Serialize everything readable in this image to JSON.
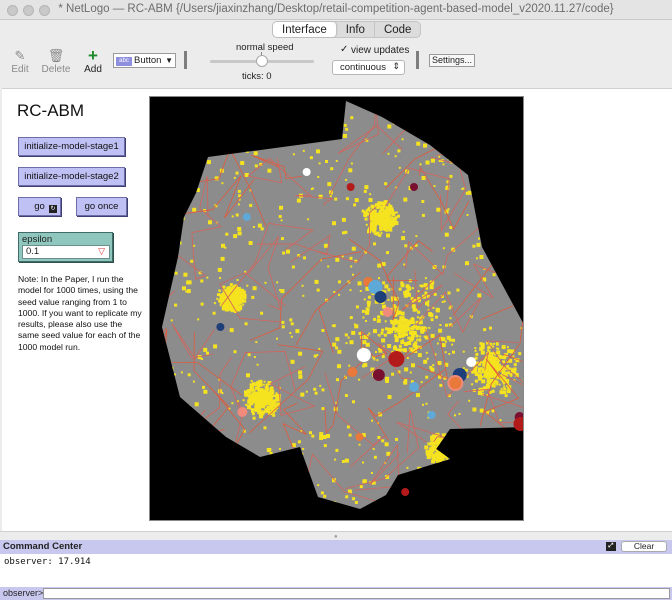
{
  "window": {
    "title": "* NetLogo — RC-ABM {/Users/jiaxinzhang/Desktop/retail-competition-agent-based-model_v2020.11.27/code}"
  },
  "tabs": [
    {
      "label": "Interface",
      "active": true
    },
    {
      "label": "Info",
      "active": false
    },
    {
      "label": "Code",
      "active": false
    }
  ],
  "toolbar": {
    "edit_label": "Edit",
    "delete_label": "Delete",
    "add_label": "Add",
    "widget_type": "Button",
    "widget_type_icon": "abc",
    "speed_label": "normal speed",
    "ticks_label": "ticks: 0",
    "view_updates_label": "view updates",
    "view_updates_checked": true,
    "update_mode": "continuous",
    "settings_label": "Settings..."
  },
  "interface": {
    "model_title": "RC-ABM",
    "buttons": {
      "init1": "initialize-model-stage1",
      "init2": "initialize-model-stage2",
      "go": "go",
      "go_once": "go once"
    },
    "chooser": {
      "label": "epsilon",
      "value": "0.1"
    },
    "note": "Note: In the Paper, I run the model for 1000 times, using the seed value ranging from 1 to 1000. If you want to replicate my results, please also use the same seed value for each of the 1000 model run."
  },
  "world_view": {
    "background": "#000000",
    "land_color": "#8c8c8c",
    "urban_color": "#f5e320",
    "road_color": "#e05a3c",
    "boundary_color": "#d4645a"
  },
  "command_center": {
    "title": "Command Center",
    "clear_label": "Clear",
    "output": "observer: 17.914",
    "prompt": "observer>",
    "input_value": ""
  }
}
